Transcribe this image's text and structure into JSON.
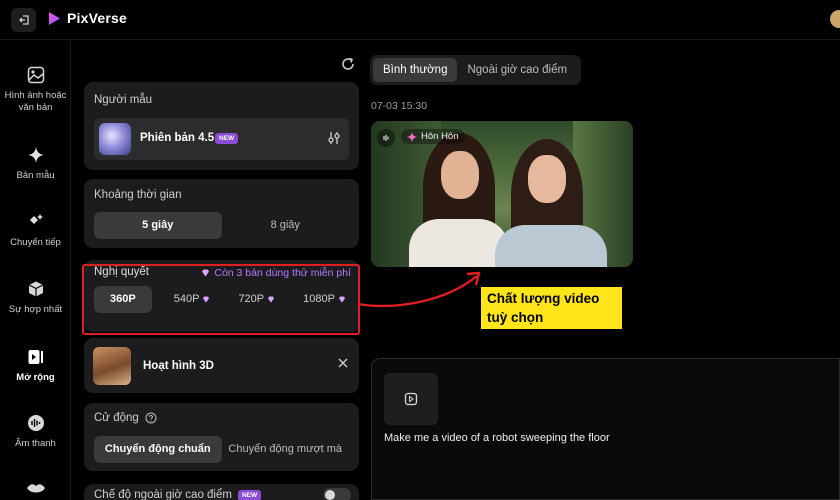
{
  "app": {
    "name": "PixVerse"
  },
  "nav": {
    "items": [
      {
        "label": "Hình ảnh hoặc văn bản",
        "icon": "image-icon"
      },
      {
        "label": "Bản mẫu",
        "icon": "sparkle-icon"
      },
      {
        "label": "Chuyển tiếp",
        "icon": "transition-icon"
      },
      {
        "label": "Sự hợp nhất",
        "icon": "cube-icon"
      },
      {
        "label": "Mở rộng",
        "icon": "extend-icon",
        "active": true
      },
      {
        "label": "Âm thanh",
        "icon": "audio-icon"
      }
    ]
  },
  "model": {
    "title": "Người mẫu",
    "name": "Phiên bản 4.5",
    "badge": "NEW"
  },
  "duration": {
    "title": "Khoảng thời gian",
    "options": [
      "5 giây",
      "8 giây"
    ],
    "selected": "5 giây"
  },
  "resolution": {
    "title": "Nghị quyết",
    "trial_text": "Còn 3 bản dùng thử miễn phí",
    "options": [
      "360P",
      "540P",
      "720P",
      "1080P"
    ],
    "selected": "360P"
  },
  "style": {
    "name": "Hoạt hình 3D"
  },
  "motion": {
    "title": "Cử động",
    "options": [
      "Chuyển động chuẩn",
      "Chuyển động mượt mà"
    ],
    "selected": "Chuyển động chuẩn"
  },
  "offpeak": {
    "title": "Chế độ ngoài giờ cao điểm",
    "badge": "NEW",
    "enabled": false
  },
  "mode_tabs": {
    "options": [
      "Bình thường",
      "Ngoài giờ cao điểm"
    ],
    "selected": "Bình thường"
  },
  "result": {
    "timestamp": "07-03 15:30",
    "tag": "Hôn Hôn"
  },
  "annotation": {
    "line1": "Chất lượng video",
    "line2": "tuỳ chọn"
  },
  "prompt": {
    "text": "Make me a video of a robot sweeping the floor"
  },
  "colors": {
    "accent": "#b57bff",
    "highlight_box": "#e02020",
    "annotation_bg": "#ffe51a",
    "badge": "#8a4bd6"
  }
}
